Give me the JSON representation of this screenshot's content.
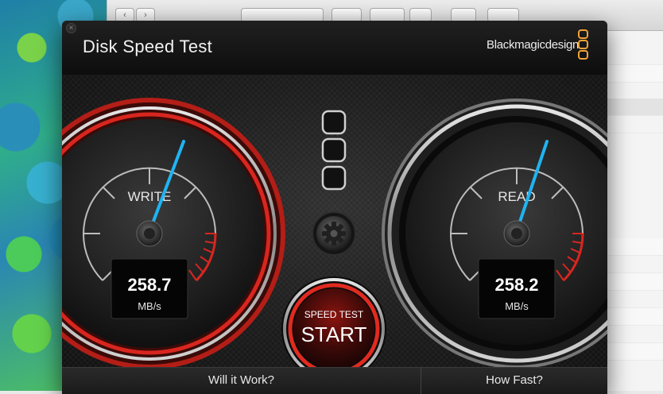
{
  "app": {
    "title": "Disk Speed Test",
    "brand": "Blackmagicdesign",
    "close_glyph": "×"
  },
  "write_gauge": {
    "label": "WRITE",
    "value": "258.7",
    "unit": "MB/s"
  },
  "read_gauge": {
    "label": "READ",
    "value": "258.2",
    "unit": "MB/s"
  },
  "start_button": {
    "line1": "SPEED TEST",
    "line2": "START"
  },
  "footer": {
    "tab_will_it_work": "Will it Work?",
    "tab_how_fast": "How Fast?"
  },
  "colors": {
    "needle": "#1fb4f2",
    "accent_red": "#d8261f",
    "brand_orange": "#f0a23a"
  },
  "icons": {
    "settings": "gear-icon",
    "close": "close-icon",
    "back": "chevron-left-icon",
    "forward": "chevron-right-icon"
  }
}
